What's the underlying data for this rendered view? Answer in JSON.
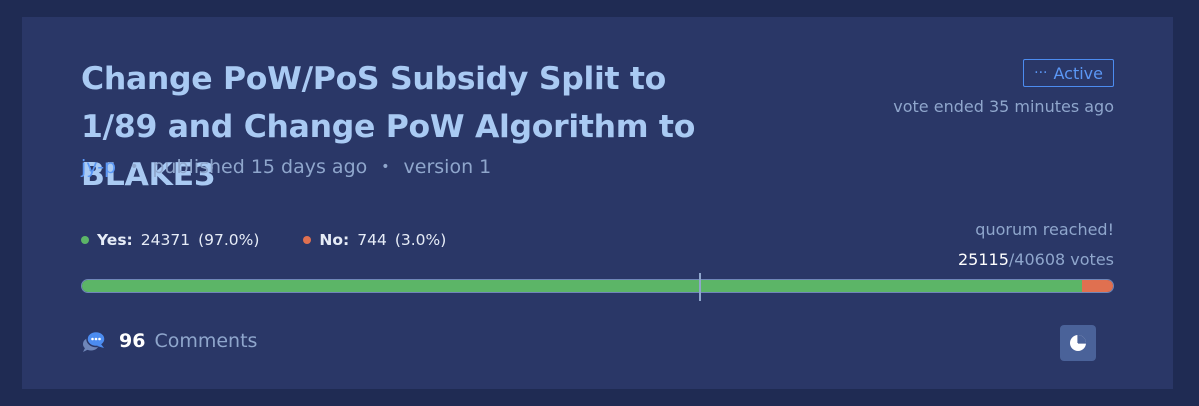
{
  "proposal": {
    "title": "Change PoW/PoS Subsidy Split to 1/89 and Change PoW Algorithm to BLAKE3",
    "author": "jy-p",
    "published": "published 15 days ago",
    "version": "version 1",
    "separator": "•"
  },
  "status": {
    "dots": "···",
    "label": "Active",
    "vote_ended": "vote ended 35 minutes ago",
    "color": "#4c8cf0"
  },
  "votes": {
    "yes": {
      "label": "Yes:",
      "count": "24371",
      "percent": "(97.0%)",
      "fraction": 0.97,
      "color": "#5cb567"
    },
    "no": {
      "label": "No:",
      "count": "744",
      "percent": "(3.0%)",
      "fraction": 0.03,
      "color": "#e07050"
    },
    "quorum_text": "quorum reached!",
    "cast": "25115",
    "eligible": "/40608 votes"
  },
  "comments": {
    "count": "96",
    "label": "Comments",
    "icon": "comment-bubble-icon"
  },
  "chart_button": {
    "icon": "pie-chart-icon"
  }
}
